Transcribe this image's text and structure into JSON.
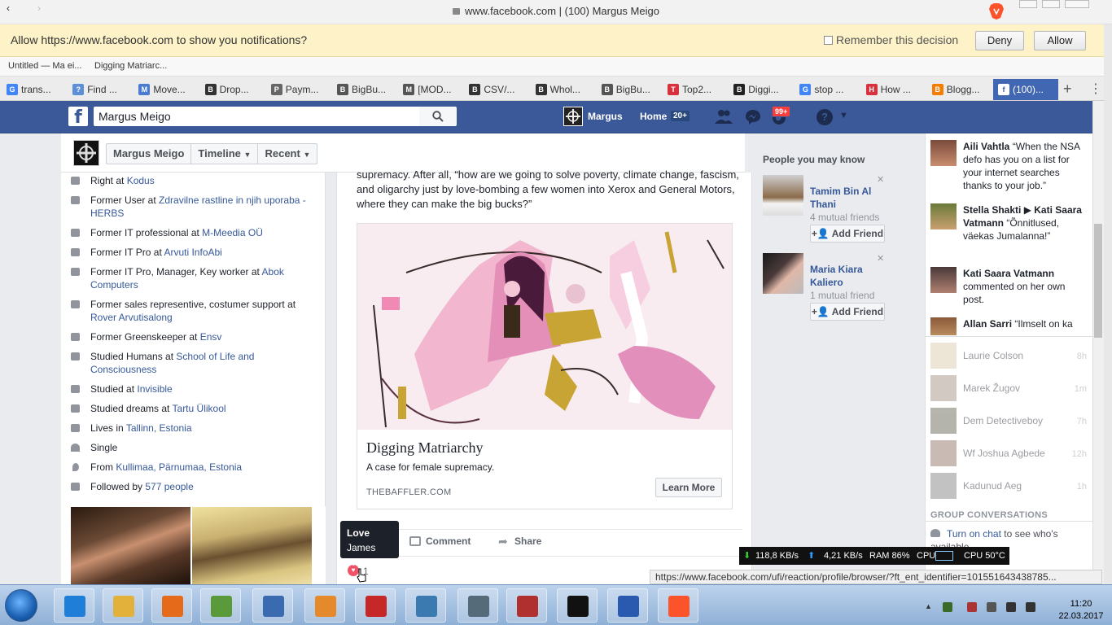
{
  "browser": {
    "url_title": "www.facebook.com | (100) Margus Meigo",
    "notification_bar": {
      "message": "Allow https://www.facebook.com to show you notifications?",
      "remember_label": "Remember this decision",
      "deny_label": "Deny",
      "allow_label": "Allow"
    },
    "bookmarks": [
      "Untitled — Ma ei...",
      "Digging Matriarc..."
    ],
    "tabs": [
      {
        "label": "trans...",
        "color": "#4285f4",
        "glyph": "G"
      },
      {
        "label": "Find ...",
        "color": "#5b8fd6",
        "glyph": "?"
      },
      {
        "label": "Move...",
        "color": "#4a7bd0",
        "glyph": "M"
      },
      {
        "label": "Drop...",
        "color": "#333333",
        "glyph": "B"
      },
      {
        "label": "Paym...",
        "color": "#666666",
        "glyph": "P"
      },
      {
        "label": "BigBu...",
        "color": "#555555",
        "glyph": "B"
      },
      {
        "label": "[MOD...",
        "color": "#555555",
        "glyph": "M"
      },
      {
        "label": "CSV/...",
        "color": "#333333",
        "glyph": "B"
      },
      {
        "label": "Whol...",
        "color": "#333333",
        "glyph": "B"
      },
      {
        "label": "BigBu...",
        "color": "#555555",
        "glyph": "B"
      },
      {
        "label": "Top2...",
        "color": "#d9303e",
        "glyph": "T"
      },
      {
        "label": "Diggi...",
        "color": "#222222",
        "glyph": "B"
      },
      {
        "label": "stop ...",
        "color": "#4285f4",
        "glyph": "G"
      },
      {
        "label": "How ...",
        "color": "#d9303e",
        "glyph": "H"
      },
      {
        "label": "Blogg...",
        "color": "#f57d00",
        "glyph": "B"
      },
      {
        "label": "(100)...",
        "color": "#3b5998",
        "glyph": "f"
      }
    ],
    "status_url": "https://www.facebook.com/ufi/reaction/profile/browser/?ft_ent_identifier=101551643438785...",
    "icons": {
      "back": "chevron-left-icon",
      "forward": "chevron-right-icon",
      "lock": "lock-icon",
      "brave": "brave-lion-icon"
    }
  },
  "fb_header": {
    "search_value": "Margus Meigo",
    "user_name": "Margus",
    "home_label": "Home",
    "home_count": "20+",
    "notif_count": "99+"
  },
  "profile_bar": {
    "name": "Margus Meigo",
    "timeline_label": "Timeline",
    "recent_label": "Recent"
  },
  "intro": [
    {
      "icon": "briefcase-icon",
      "prefix": "Right at ",
      "link": "Kodus"
    },
    {
      "icon": "briefcase-icon",
      "prefix": "Former User at ",
      "link": "Zdravilne rastline in njih uporaba - HERBS"
    },
    {
      "icon": "briefcase-icon",
      "prefix": "Former IT professional at ",
      "link": "M-Meedia OÜ"
    },
    {
      "icon": "briefcase-icon",
      "prefix": "Former IT Pro at ",
      "link": "Arvuti InfoAbi"
    },
    {
      "icon": "briefcase-icon",
      "prefix": "Former IT Pro, Manager, Key worker at ",
      "link": "Abok Computers"
    },
    {
      "icon": "briefcase-icon",
      "prefix": "Former sales representive, costumer support at ",
      "link": "Rover Arvutisalong"
    },
    {
      "icon": "briefcase-icon",
      "prefix": "Former Greenskeeper at ",
      "link": "Ensv"
    },
    {
      "icon": "graduation-cap-icon",
      "prefix": "Studied Humans at ",
      "link": "School of Life and Consciousness"
    },
    {
      "icon": "graduation-cap-icon",
      "prefix": "Studied at ",
      "link": "Invisible"
    },
    {
      "icon": "graduation-cap-icon",
      "prefix": "Studied dreams at ",
      "link": "Tartu Ülikool"
    },
    {
      "icon": "house-icon",
      "prefix": "Lives in ",
      "link": "Tallinn, Estonia"
    },
    {
      "icon": "heart-icon",
      "prefix": "Single",
      "link": ""
    },
    {
      "icon": "map-pin-icon",
      "prefix": "From ",
      "link": "Kullimaa, Pärnumaa, Estonia"
    },
    {
      "icon": "rss-icon",
      "prefix": "Followed by ",
      "link": "577 people"
    }
  ],
  "post": {
    "text": "supremacy. After all, “how are we going to solve poverty, climate change, fascism, and oligarchy just by love-bombing a few women into Xerox and General Motors, where they can make the big bucks?”",
    "attachment": {
      "title": "Digging Matriarchy",
      "description": "A case for female supremacy.",
      "domain": "THEBAFFLER.COM",
      "button": "Learn More"
    },
    "tooltip": {
      "reaction": "Love",
      "person": "James Wu"
    },
    "comment_label": "Comment",
    "share_label": "Share",
    "reaction_count": "1"
  },
  "pymk": {
    "title": "People you may know",
    "people": [
      {
        "name": "Tamim Bin Al Thani",
        "mutual": "4 mutual friends",
        "button": "Add Friend"
      },
      {
        "name": "Maria Kiara Kaliero",
        "mutual": "1 mutual friend",
        "button": "Add Friend"
      }
    ]
  },
  "ticker": [
    {
      "name": "Aili Vahtla",
      "text": " “When the NSA defo has you on a list for your internet searches thanks to your job.”"
    },
    {
      "name": "Stella Shakti ▶ Kati Saara Vatmann",
      "text": " “Õnnitlused, väekas Jumalanna!”"
    },
    {
      "name": "Kati Saara Vatmann",
      "text": " commented on her own post."
    },
    {
      "name": "Allan Sarri",
      "text": " “Ilmselt on ka"
    }
  ],
  "chat": [
    {
      "name": "Laurie Colson",
      "time": "8h"
    },
    {
      "name": "Marek Žugov",
      "time": "1m"
    },
    {
      "name": "Dem Detectiveboy",
      "time": "7h"
    },
    {
      "name": "Wf Joshua Agbede",
      "time": "12h"
    },
    {
      "name": "Kadunud Aeg",
      "time": "1h"
    }
  ],
  "group_conversations": "GROUP CONVERSATIONS",
  "chat_on": {
    "link": "Turn on chat",
    "text": " to see who's available."
  },
  "netmeter": {
    "down": "118,8 KB/s",
    "up": "4,21 KB/s",
    "ram": "RAM 86%",
    "cpu": "CPU",
    "cpu_temp": "CPU 50°C"
  },
  "taskbar": {
    "time": "11:20",
    "date": "22.03.2017"
  },
  "colors": {
    "fb_blue": "#3b5998",
    "link": "#365899",
    "love": "#f25268",
    "notif_bg": "#fdf2c8"
  }
}
